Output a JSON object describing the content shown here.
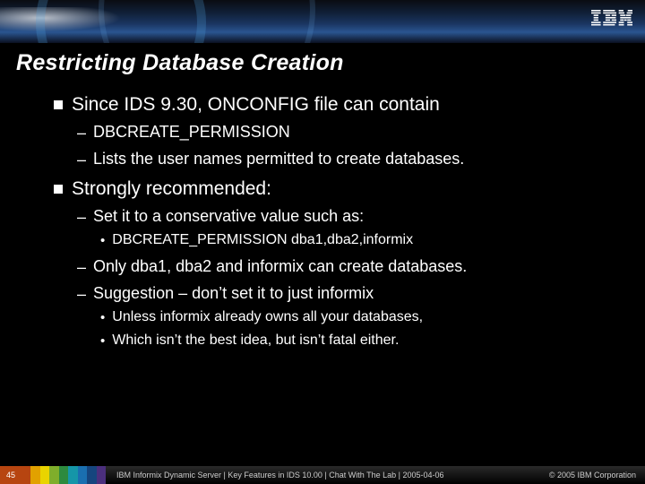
{
  "logo_text": "IBM",
  "title": "Restricting Database Creation",
  "bullets": {
    "b1a": "Since IDS 9.30, ONCONFIG file can contain",
    "b1a_s1": "DBCREATE_PERMISSION",
    "b1a_s2": "Lists the user names permitted to create databases.",
    "b1b": "Strongly recommended:",
    "b1b_s1": "Set it to a conservative value such as:",
    "b1b_s1_s1": "DBCREATE_PERMISSION dba1,dba2,informix",
    "b1b_s2": "Only dba1, dba2 and informix can create databases.",
    "b1b_s3": "Suggestion – don’t set it to just informix",
    "b1b_s3_s1": "Unless informix already owns all your databases,",
    "b1b_s3_s2": "Which isn’t the best idea, but isn’t fatal either."
  },
  "footer": {
    "page": "45",
    "text": "IBM Informix Dynamic Server | Key Features in IDS 10.00 | Chat With The Lab | 2005-04-06",
    "copyright": "© 2005 IBM Corporation"
  },
  "rainbow": [
    "#b74510",
    "#e2a100",
    "#e9d400",
    "#7fae2b",
    "#2d8a3e",
    "#1596a8",
    "#1a6fb0",
    "#16457e",
    "#4b2f7d"
  ]
}
